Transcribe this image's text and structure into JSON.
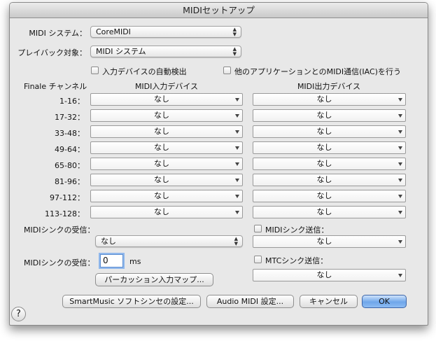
{
  "window": {
    "title": "MIDIセットアップ"
  },
  "midi_system": {
    "label": "MIDI システム：",
    "value": "CoreMIDI"
  },
  "playback_target": {
    "label": "プレイバック対象：",
    "value": "MIDI システム"
  },
  "options": {
    "auto_detect_input": "入力デバイスの自動検出",
    "iac": "他のアプリケーションとのMIDI通信(IAC)を行う"
  },
  "table": {
    "header_channel": "Finale チャンネル",
    "header_input": "MIDI入力デバイス",
    "header_output": "MIDI出力デバイス",
    "rows": [
      {
        "range": "1-16：",
        "input": "なし",
        "output": "なし"
      },
      {
        "range": "17-32：",
        "input": "なし",
        "output": "なし"
      },
      {
        "range": "33-48：",
        "input": "なし",
        "output": "なし"
      },
      {
        "range": "49-64：",
        "input": "なし",
        "output": "なし"
      },
      {
        "range": "65-80：",
        "input": "なし",
        "output": "なし"
      },
      {
        "range": "81-96：",
        "input": "なし",
        "output": "なし"
      },
      {
        "range": "97-112：",
        "input": "なし",
        "output": "なし"
      },
      {
        "range": "113-128：",
        "input": "なし",
        "output": "なし"
      }
    ]
  },
  "sync": {
    "receive_label": "MIDIシンクの受信：",
    "receive_value": "なし",
    "receive_ms_label": "MIDIシンクの受信：",
    "receive_ms_value": "0",
    "ms_unit": "ms",
    "send_label": "MIDIシンク送信：",
    "send_value": "なし",
    "mtc_label": "MTCシンク送信：",
    "mtc_value": "なし"
  },
  "buttons": {
    "percussion_map": "パーカッション入力マップ...",
    "smartmusic": "SmartMusic ソフトシンセの設定...",
    "audio_midi": "Audio MIDI 設定...",
    "cancel": "キャンセル",
    "ok": "OK",
    "help": "?"
  },
  "colors": {
    "default_button": "#6fa6ea",
    "focus_ring": "#90b8ec"
  }
}
